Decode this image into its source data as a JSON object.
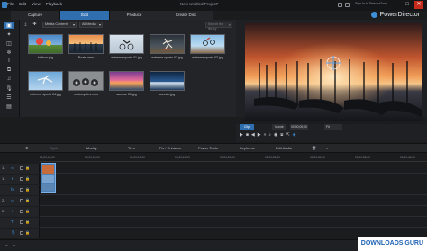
{
  "titlebar": {
    "menu": [
      "File",
      "Edit",
      "View",
      "Playback"
    ],
    "title": "New Untitled Project*",
    "user_link": "Sign In to DirectorZone",
    "controls": [
      "minimize-icon",
      "maximize-icon",
      "close-icon"
    ]
  },
  "modes": [
    "Capture",
    "Edit",
    "Produce",
    "Create Disc"
  ],
  "active_mode": "Edit",
  "brand": "PowerDirector",
  "library": {
    "filter": "Media Content",
    "media_filter": "All Media",
    "search_placeholder": "Search the library",
    "items": [
      {
        "name": "balloon.jpg",
        "icon": "balloon-thumb"
      },
      {
        "name": "Boats.wmv",
        "icon": "boats-thumb"
      },
      {
        "name": "extreme sports 01.jpg",
        "icon": "bmx-thumb"
      },
      {
        "name": "extreme sports 02.jpg",
        "icon": "skater-thumb"
      },
      {
        "name": "extreme sports 03.jpg",
        "icon": "bike-jump-thumb"
      },
      {
        "name": "extreme sports 04.jpg",
        "icon": "skydive-thumb"
      },
      {
        "name": "motorcycles.mpo",
        "icon": "motorcycles-thumb"
      },
      {
        "name": "sunrise 01.jpg",
        "icon": "sunrise-thumb"
      },
      {
        "name": "sunrise.jpg",
        "icon": "sunset-thumb"
      }
    ]
  },
  "preview": {
    "clip_tab": "Clip",
    "movie_tab": "Movie",
    "timecode": "00;00;00;00",
    "fit_label": "Fit"
  },
  "ribbon": {
    "split": "Split",
    "modify": "Modify",
    "trim": "Trim",
    "fix_enhance": "Fix / Enhance",
    "power_tools": "Power Tools",
    "keyframe": "Keyframe",
    "edit_audio": "Edit Audio"
  },
  "timeline": {
    "ticks": [
      "00;00;00;00",
      "00;00;05;00",
      "00;00;10;00",
      "00;00;15;00",
      "00;00;20;00",
      "00;00;25;00",
      "00;00;30;00",
      "00;00;35;00",
      "00;00;40;00"
    ],
    "tracks": [
      {
        "num": "1.",
        "icon": "video-track-icon"
      },
      {
        "num": "1.",
        "icon": "audio-track-icon"
      },
      {
        "num": "",
        "icon": "fx-track-icon"
      },
      {
        "num": "2.",
        "icon": "video-track-icon"
      },
      {
        "num": "2.",
        "icon": "audio-track-icon"
      },
      {
        "num": "",
        "icon": "title-track-icon"
      },
      {
        "num": "",
        "icon": "voice-track-icon"
      },
      {
        "num": "",
        "icon": "music-track-icon"
      }
    ]
  },
  "watermark": {
    "text": "DOWNLOADS",
    "suffix": ".GURU"
  }
}
